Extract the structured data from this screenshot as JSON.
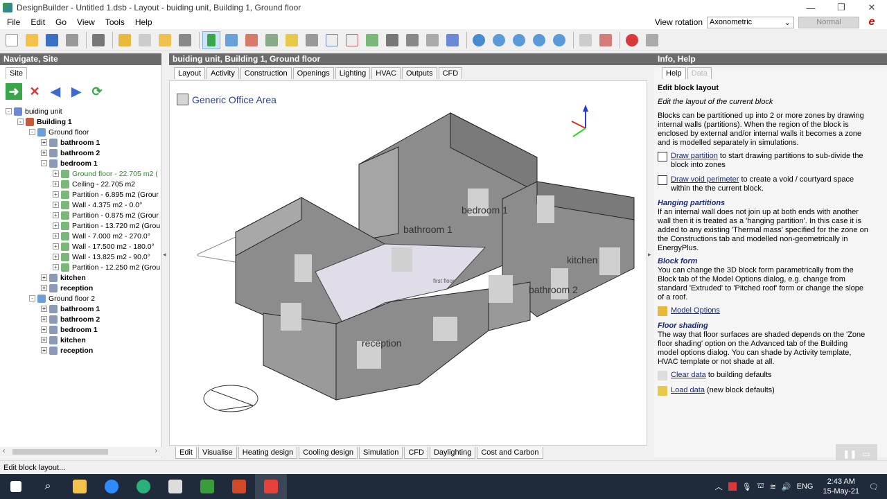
{
  "window": {
    "title": "DesignBuilder - Untitled 1.dsb - Layout - buiding unit, Building 1, Ground floor",
    "minimize": "—",
    "maximize": "❐",
    "close": "✕"
  },
  "menu": [
    "File",
    "Edit",
    "Go",
    "View",
    "Tools",
    "Help"
  ],
  "view_rotation": {
    "label": "View rotation",
    "value": "Axonometric",
    "mode": "Normal"
  },
  "left_panel": {
    "title": "Navigate, Site",
    "tab": "Site",
    "tree": [
      {
        "label": "buiding unit",
        "level": 0,
        "exp": "-",
        "bold": false,
        "color": "normal"
      },
      {
        "label": "Building 1",
        "level": 1,
        "exp": "-",
        "bold": true,
        "color": "normal"
      },
      {
        "label": "Ground floor",
        "level": 2,
        "exp": "-",
        "bold": false,
        "color": "normal"
      },
      {
        "label": "bathroom 1",
        "level": 3,
        "exp": "+",
        "bold": true,
        "color": "normal"
      },
      {
        "label": "bathroom 2",
        "level": 3,
        "exp": "+",
        "bold": true,
        "color": "normal"
      },
      {
        "label": "bedroom 1",
        "level": 3,
        "exp": "-",
        "bold": true,
        "color": "normal"
      },
      {
        "label": "Ground floor - 22.705 m2 (",
        "level": 4,
        "exp": "+",
        "bold": false,
        "color": "green"
      },
      {
        "label": "Ceiling - 22.705 m2",
        "level": 4,
        "exp": "+",
        "bold": false,
        "color": "normal"
      },
      {
        "label": "Partition - 6.895 m2 (Grour",
        "level": 4,
        "exp": "+",
        "bold": false,
        "color": "normal"
      },
      {
        "label": "Wall - 4.375 m2 - 0.0°",
        "level": 4,
        "exp": "+",
        "bold": false,
        "color": "normal"
      },
      {
        "label": "Partition - 0.875 m2 (Grour",
        "level": 4,
        "exp": "+",
        "bold": false,
        "color": "normal"
      },
      {
        "label": "Partition - 13.720 m2 (Grou",
        "level": 4,
        "exp": "+",
        "bold": false,
        "color": "normal"
      },
      {
        "label": "Wall - 7.000 m2 - 270.0°",
        "level": 4,
        "exp": "+",
        "bold": false,
        "color": "normal"
      },
      {
        "label": "Wall - 17.500 m2 - 180.0°",
        "level": 4,
        "exp": "+",
        "bold": false,
        "color": "normal"
      },
      {
        "label": "Wall - 13.825 m2 - 90.0°",
        "level": 4,
        "exp": "+",
        "bold": false,
        "color": "normal"
      },
      {
        "label": "Partition - 12.250 m2 (Grou",
        "level": 4,
        "exp": "+",
        "bold": false,
        "color": "normal"
      },
      {
        "label": "kitchen",
        "level": 3,
        "exp": "+",
        "bold": true,
        "color": "normal"
      },
      {
        "label": "reception",
        "level": 3,
        "exp": "+",
        "bold": true,
        "color": "normal"
      },
      {
        "label": "Ground floor 2",
        "level": 2,
        "exp": "-",
        "bold": false,
        "color": "normal"
      },
      {
        "label": "bathroom 1",
        "level": 3,
        "exp": "+",
        "bold": true,
        "color": "normal"
      },
      {
        "label": "bathroom 2",
        "level": 3,
        "exp": "+",
        "bold": true,
        "color": "normal"
      },
      {
        "label": "bedroom 1",
        "level": 3,
        "exp": "+",
        "bold": true,
        "color": "normal"
      },
      {
        "label": "kitchen",
        "level": 3,
        "exp": "+",
        "bold": true,
        "color": "normal"
      },
      {
        "label": "reception",
        "level": 3,
        "exp": "+",
        "bold": true,
        "color": "normal"
      }
    ]
  },
  "center": {
    "title": "buiding unit, Building 1, Ground floor",
    "tabs": [
      "Layout",
      "Activity",
      "Construction",
      "Openings",
      "Lighting",
      "HVAC",
      "Outputs",
      "CFD"
    ],
    "active_tab": "Layout",
    "legend": "Generic Office Area",
    "rooms": {
      "bathroom1": "bathroom 1",
      "bedroom1": "bedroom 1",
      "kitchen": "kitchen",
      "bathroom2": "bathroom 2",
      "reception": "reception",
      "first_floor": "first floor"
    },
    "bottom_tabs": [
      "Edit",
      "Visualise",
      "Heating design",
      "Cooling design",
      "Simulation",
      "CFD",
      "Daylighting",
      "Cost and Carbon"
    ],
    "active_bottom_tab": "Edit"
  },
  "right_panel": {
    "title": "Info, Help",
    "tabs": [
      "Help",
      "Data"
    ],
    "heading": "Edit block layout",
    "subheading": "Edit the layout of the current block",
    "intro": "Blocks can be partitioned up into 2 or more zones by drawing internal walls (partitions).  When the region of the block is enclosed by external and/or internal walls it becomes a zone and is modelled separately in simulations.",
    "draw_partition_link": "Draw partition",
    "draw_partition_text": " to start drawing partitions to sub-divide the block into zones",
    "draw_void_link": "Draw void perimeter",
    "draw_void_text": " to create a void / courtyard space within the the current block.",
    "hanging_title": "Hanging partitions",
    "hanging_text": "If an internal wall does not join up at both ends with another wall then it is treated as a 'hanging partition'.  In this case it is added to any existing 'Thermal mass' specified for the zone on the Constructions tab and modelled non-geometrically in EnergyPlus.",
    "block_form_title": "Block form",
    "block_form_text": "You can change the 3D block form parametrically from the Block tab of the Model Options dialog, e.g. change from standard 'Extruded' to 'Pitched roof' form or change the slope of a roof.",
    "model_options_link": "Model Options",
    "floor_shading_title": "Floor shading",
    "floor_shading_text": "The way that floor surfaces are shaded depends on the 'Zone floor shading' option on the Advanced tab of the Building model options dialog. You can shade by Activity template, HVAC template or not shade at all.",
    "clear_data_link": "Clear data",
    "clear_data_text": " to building defaults",
    "load_data_link": "Load data",
    "load_data_text": " (new block defaults)"
  },
  "status_bar": "Edit block layout...",
  "taskbar": {
    "time": "2:43 AM",
    "date": "15-May-21",
    "lang": "ENG"
  }
}
